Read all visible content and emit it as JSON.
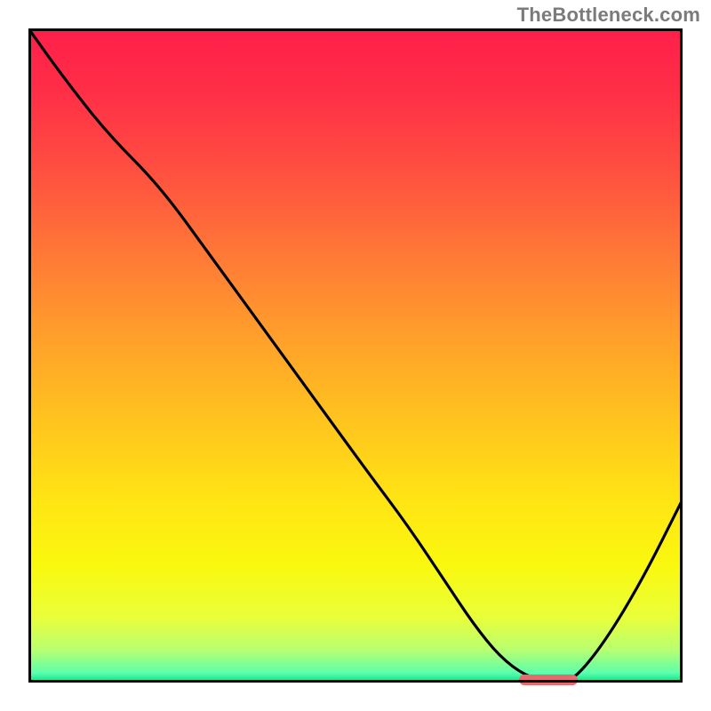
{
  "watermark": "TheBottleneck.com",
  "colors": {
    "gradient_stops": [
      {
        "offset": 0.0,
        "color": "#ff1f4a"
      },
      {
        "offset": 0.1,
        "color": "#ff2f47"
      },
      {
        "offset": 0.22,
        "color": "#ff5040"
      },
      {
        "offset": 0.35,
        "color": "#ff7a36"
      },
      {
        "offset": 0.48,
        "color": "#ffa22a"
      },
      {
        "offset": 0.6,
        "color": "#ffc41e"
      },
      {
        "offset": 0.72,
        "color": "#ffe414"
      },
      {
        "offset": 0.82,
        "color": "#faf80e"
      },
      {
        "offset": 0.9,
        "color": "#e9ff3a"
      },
      {
        "offset": 0.95,
        "color": "#b8ff70"
      },
      {
        "offset": 0.985,
        "color": "#5dffad"
      },
      {
        "offset": 1.0,
        "color": "#00e28a"
      }
    ],
    "curve": "#000000",
    "marker": "#e66a6f",
    "frame": "#000000"
  },
  "chart_data": {
    "type": "line",
    "title": "",
    "xlabel": "",
    "ylabel": "",
    "xlim": [
      0,
      100
    ],
    "ylim": [
      0,
      100
    ],
    "grid": false,
    "series": [
      {
        "name": "bottleneck-curve",
        "x": [
          0,
          5,
          12,
          20,
          28,
          36,
          44,
          52,
          58,
          64,
          68,
          72,
          76,
          80,
          83,
          88,
          94,
          100
        ],
        "y": [
          100,
          93,
          84,
          76,
          65,
          54,
          43,
          32,
          24,
          15,
          9,
          4,
          1,
          0,
          0,
          6,
          16,
          28
        ]
      }
    ],
    "annotations": [
      {
        "name": "optimal-range-marker",
        "x_start": 75,
        "x_end": 84,
        "y": 0
      }
    ],
    "legend": false
  }
}
